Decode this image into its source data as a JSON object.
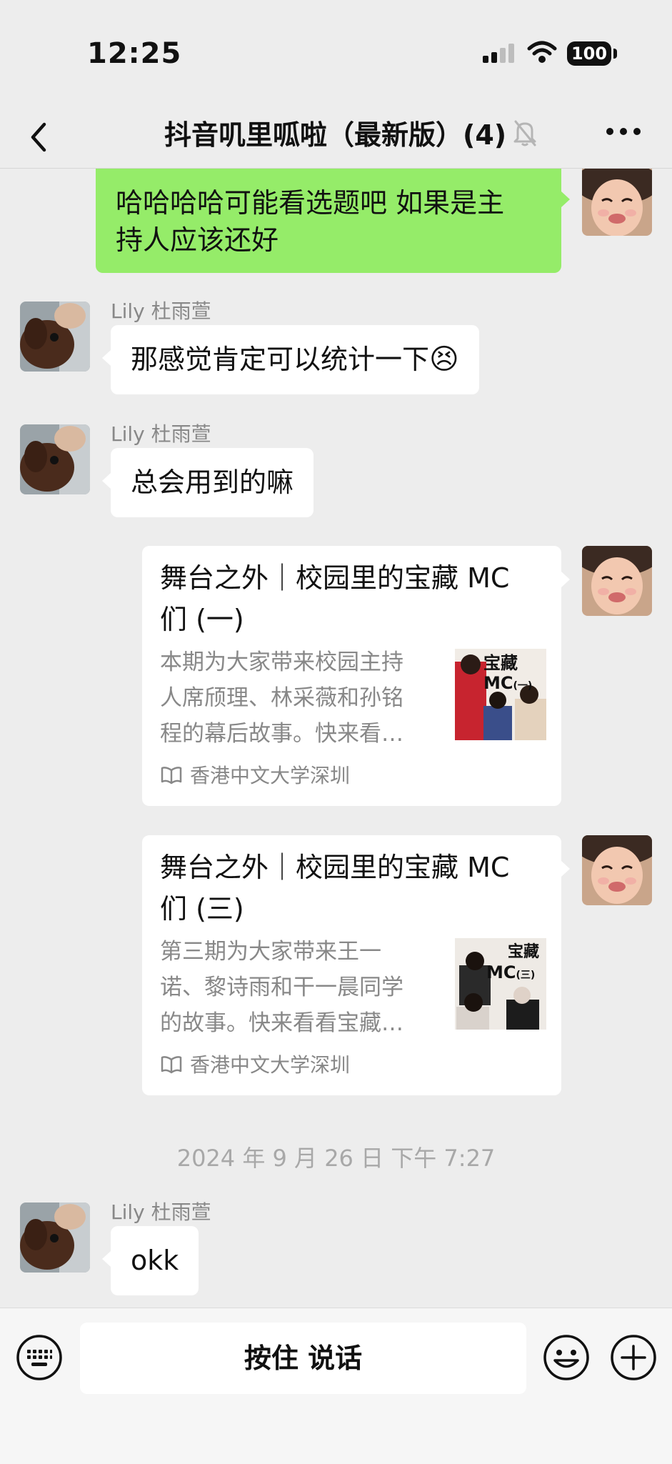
{
  "status_bar": {
    "time": "12:25",
    "battery": "100"
  },
  "nav": {
    "title": "抖音叽里呱啦（最新版）(4)"
  },
  "messages": [
    {
      "side": "right",
      "text_line1": "哈哈哈哈可能看选题吧 如果是主",
      "text_line2": "持人应该还好"
    },
    {
      "side": "left",
      "sender": "Lily 杜雨萱",
      "text": "那感觉肯定可以统计一下",
      "emoji": "😣"
    },
    {
      "side": "left",
      "sender": "Lily 杜雨萱",
      "text": "总会用到的嘛"
    },
    {
      "side": "right",
      "type": "card",
      "title_line1": "舞台之外｜校园里的宝藏 MC",
      "title_line2": "们 (一)",
      "desc_line1": "本期为大家带来校园主持",
      "desc_line2": "人席颀理、林采薇和孙铭",
      "desc_line3": "程的幕后故事。快来看…",
      "thumb_text": "宝藏",
      "thumb_text2": "MC",
      "thumb_text3": "(一)",
      "source": "香港中文大学深圳"
    },
    {
      "side": "right",
      "type": "card",
      "title_line1": "舞台之外｜校园里的宝藏 MC",
      "title_line2": "们 (三)",
      "desc_line1": "第三期为大家带来王一",
      "desc_line2": "诺、黎诗雨和干一晨同学",
      "desc_line3": "的故事。快来看看宝藏…",
      "thumb_text": "宝藏",
      "thumb_text2": "MC",
      "thumb_text3": "(三)",
      "source": "香港中文大学深圳"
    },
    {
      "side": "system",
      "text": "2024 年 9 月 26 日 下午 7:27"
    },
    {
      "side": "left",
      "sender": "Lily 杜雨萱",
      "text": "okk"
    }
  ],
  "input_bar": {
    "hold_to_talk": "按住 说话"
  },
  "icons": {
    "status": [
      "signal-icon",
      "wifi-icon"
    ],
    "nav": [
      "back-icon",
      "mute-icon",
      "more-icon"
    ],
    "input": [
      "keyboard-icon",
      "emoji-icon",
      "plus-icon"
    ],
    "card": [
      "book-icon"
    ]
  },
  "colors": {
    "background": "#ededed",
    "sent_bubble": "#95ec69",
    "received_bubble": "#ffffff",
    "secondary_text": "#888888"
  }
}
